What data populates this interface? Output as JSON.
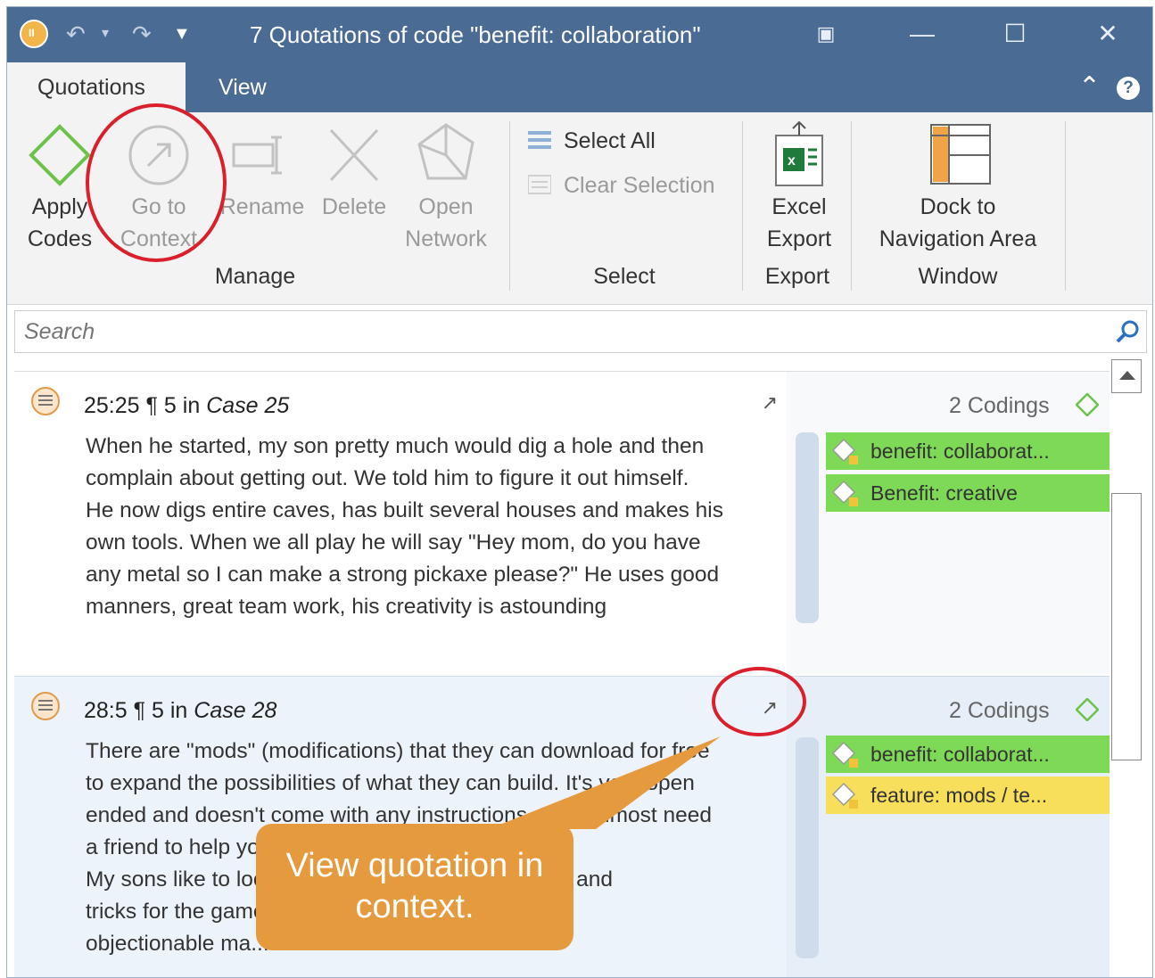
{
  "window": {
    "title": "7 Quotations of code \"benefit: collaboration\""
  },
  "tabs": [
    {
      "label": "Quotations"
    },
    {
      "label": "View"
    }
  ],
  "ribbon": {
    "buttons": {
      "apply_codes": [
        "Apply",
        "Codes"
      ],
      "go_to_context": [
        "Go to",
        "Context"
      ],
      "rename": "Rename",
      "delete": "Delete",
      "open_network": [
        "Open",
        "Network"
      ],
      "select_all": "Select All",
      "clear_selection": "Clear Selection",
      "excel_export": [
        "Excel",
        "Export"
      ],
      "dock": [
        "Dock to",
        "Navigation Area"
      ]
    },
    "groups": {
      "manage": "Manage",
      "select": "Select",
      "export": "Export",
      "window": "Window"
    }
  },
  "search": {
    "placeholder": "Search"
  },
  "quotations": [
    {
      "id": "25:25",
      "para_mark": "¶",
      "para": "5",
      "in": "in",
      "document": "Case 25",
      "codings": "2 Codings",
      "lines": [
        "When he started, my son pretty much would dig a hole and then",
        "complain about getting out. We told him to figure it out himself.",
        "He now digs entire caves, has built several houses and makes his",
        "own tools. When we all play he will say \"Hey mom, do you have",
        "any metal so I can make a strong pickaxe please?\" He uses good",
        "manners, great team work, his creativity is astounding"
      ],
      "codes": [
        {
          "label": "benefit: collaborat...",
          "color": "green"
        },
        {
          "label": "Benefit: creative",
          "color": "green"
        }
      ]
    },
    {
      "id": "28:5",
      "para_mark": "¶",
      "para": "5",
      "in": "in",
      "document": "Case 28",
      "codings": "2 Codings",
      "lines": [
        "There are \"mods\" (modifications) that they can download for free",
        "to expand the possibilities of what they can build. It's very open",
        "ended and doesn't come with any instructions... you almost need",
        "a friend to help you figure out how things work.",
        "My sons like to look up videos that show them tips and",
        "tricks for the game and other",
        "objectionable ma..."
      ],
      "codes": [
        {
          "label": "benefit: collaborat...",
          "color": "green"
        },
        {
          "label": "feature: mods / te...",
          "color": "yellow"
        }
      ]
    }
  ],
  "annotation": {
    "callout": [
      "View quotation in",
      "context."
    ]
  },
  "colors": {
    "titlebar": "#4a6b93",
    "code_green": "#7ed957",
    "code_yellow": "#f7df5c",
    "annotation_red": "#d9202c",
    "callout_orange": "#e69a3e"
  }
}
